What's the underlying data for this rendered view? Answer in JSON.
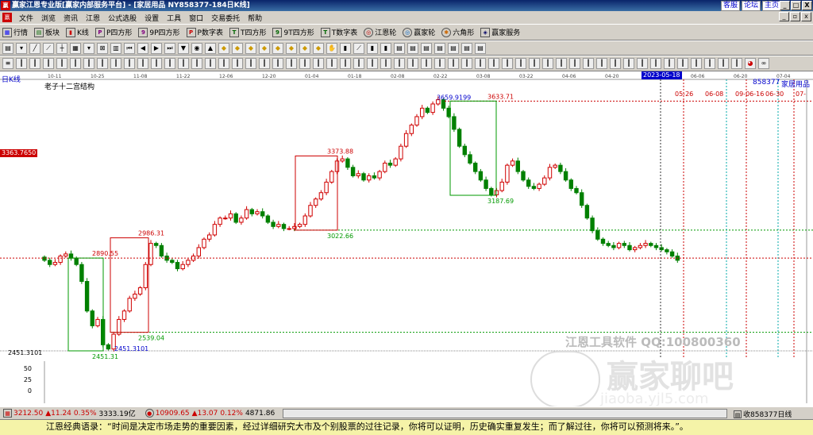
{
  "window": {
    "title": "赢家江恩专业版[赢家内部服务平台] - [家居用品  NY858377-184日K线]",
    "links": [
      "客服",
      "论坛",
      "主页"
    ],
    "buttons": [
      "_",
      "□",
      "X"
    ]
  },
  "menu": [
    "文件",
    "浏览",
    "资讯",
    "江恩",
    "公式选股",
    "设置",
    "工具",
    "窗口",
    "交易委托",
    "帮助"
  ],
  "toolbar1": [
    "行情",
    "板块",
    "K线",
    "P四方形",
    "9P四方形",
    "P数字表",
    "T四方形",
    "9T四方形",
    "T数字表",
    "江恩轮",
    "赢家轮",
    "六角形",
    "赢家服务"
  ],
  "chart": {
    "period_label": "日K线",
    "indicator_label": "老子十二宫结构",
    "code": "858377",
    "name": "家居用品",
    "date_marker": "2023-05-18",
    "left_price_tag": "3363.7650",
    "low_left": "2451.3101",
    "watermark_cn": "江恩工具软件  QQ:100800360",
    "watermark_big": "赢家聊吧",
    "watermark_url": "jiaoba.yjl5.com",
    "y_ticks": [
      "50",
      "25",
      "0"
    ],
    "date_ticks": [
      "10-11",
      "10-25",
      "11-08",
      "11-22",
      "12-06",
      "12-20",
      "01-04",
      "01-18",
      "02-08",
      "02-22",
      "03-08",
      "03-22",
      "04-06",
      "04-20",
      "05-09",
      "06-06",
      "06-20",
      "07-04"
    ],
    "future_dates": [
      "05-26",
      "06-08",
      "09-06-16",
      "06-30",
      "07-"
    ],
    "annotations": [
      "3633.71",
      "3659.9199",
      "3373.88",
      "3187.69",
      "3022.66",
      "2986.31",
      "2890.55",
      "2539.04",
      "2451.31",
      "2451.3101"
    ]
  },
  "chart_data": {
    "type": "candlestick",
    "series_name": "家居用品 858377",
    "annotated_levels": [
      {
        "label": "3633.71",
        "value": 3633.71
      },
      {
        "label": "3659.9199",
        "value": 3659.92
      },
      {
        "label": "3373.88",
        "value": 3373.88
      },
      {
        "label": "3363.7650",
        "value": 3363.765
      },
      {
        "label": "3187.69",
        "value": 3187.69
      },
      {
        "label": "3022.66",
        "value": 3022.66
      },
      {
        "label": "2986.31",
        "value": 2986.31
      },
      {
        "label": "2890.55",
        "value": 2890.55
      },
      {
        "label": "2539.04",
        "value": 2539.04
      },
      {
        "label": "2451.31",
        "value": 2451.31
      }
    ],
    "closes": [
      2880,
      2860,
      2870,
      2900,
      2910,
      2890,
      2860,
      2780,
      2640,
      2570,
      2600,
      2480,
      2460,
      2530,
      2600,
      2640,
      2700,
      2720,
      2750,
      2860,
      2960,
      2950,
      2900,
      2880,
      2870,
      2840,
      2860,
      2880,
      2900,
      2940,
      2980,
      3000,
      3050,
      3080,
      3080,
      3100,
      3060,
      3080,
      3120,
      3100,
      3110,
      3090,
      3060,
      3040,
      3050,
      3030,
      3030,
      3040,
      3050,
      3090,
      3140,
      3170,
      3200,
      3250,
      3300,
      3350,
      3360,
      3320,
      3280,
      3290,
      3260,
      3280,
      3270,
      3300,
      3340,
      3330,
      3360,
      3420,
      3480,
      3520,
      3560,
      3600,
      3580,
      3620,
      3640,
      3600,
      3560,
      3500,
      3420,
      3380,
      3340,
      3300,
      3260,
      3220,
      3190,
      3210,
      3250,
      3330,
      3350,
      3300,
      3260,
      3230,
      3220,
      3240,
      3270,
      3320,
      3330,
      3300,
      3260,
      3220,
      3200,
      3140,
      3080,
      3020,
      2980,
      2960,
      2950,
      2940,
      2960,
      2950,
      2930,
      2940,
      2950,
      2960,
      2950,
      2940,
      2930,
      2920,
      2900,
      2880
    ]
  },
  "status": {
    "idx1_value": "3212.50",
    "idx1_change": "▲11.24",
    "idx1_pct": "0.35%",
    "idx1_amount": "3333.19亿",
    "idx2_value": "10909.65",
    "idx2_change": "▲13.07",
    "idx2_pct": "0.12%",
    "idx2_amount": "4871.86",
    "right_label": "收858377日线"
  },
  "quote": "江恩经典语录：“时间是决定市场走势的重要因素，经过详细研究大市及个别股票的过往记录，你将可以证明，历史确实重复发生；而了解过往，你将可以预测将来。”。"
}
